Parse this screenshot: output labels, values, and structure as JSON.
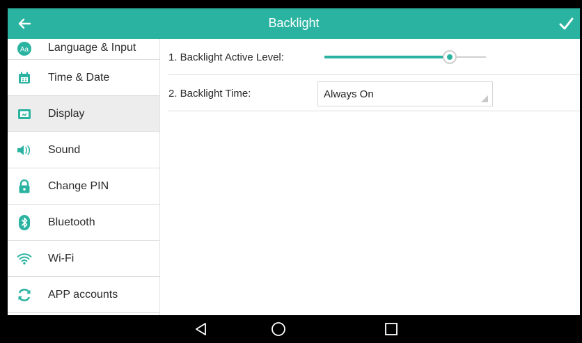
{
  "header": {
    "title": "Backlight"
  },
  "sidebar": {
    "items": [
      {
        "label": "Language & Input"
      },
      {
        "label": "Time & Date"
      },
      {
        "label": "Display"
      },
      {
        "label": "Sound"
      },
      {
        "label": "Change PIN"
      },
      {
        "label": "Bluetooth"
      },
      {
        "label": "Wi-Fi"
      },
      {
        "label": "APP accounts"
      }
    ],
    "active": "Display"
  },
  "settings": {
    "active_level": {
      "label": "1. Backlight Active Level:",
      "value_fraction": 0.77
    },
    "backlight_time": {
      "label": "2. Backlight Time:",
      "value": "Always On"
    }
  },
  "colors": {
    "accent": "#2bb3a1",
    "active_row": "#ededed"
  },
  "icons": [
    "back-arrow-icon",
    "checkmark-icon",
    "language-icon",
    "calendar-icon",
    "display-icon",
    "speaker-icon",
    "lock-icon",
    "bluetooth-icon",
    "wifi-icon",
    "sync-icon",
    "nav-back-icon",
    "nav-home-icon",
    "nav-recent-icon"
  ]
}
